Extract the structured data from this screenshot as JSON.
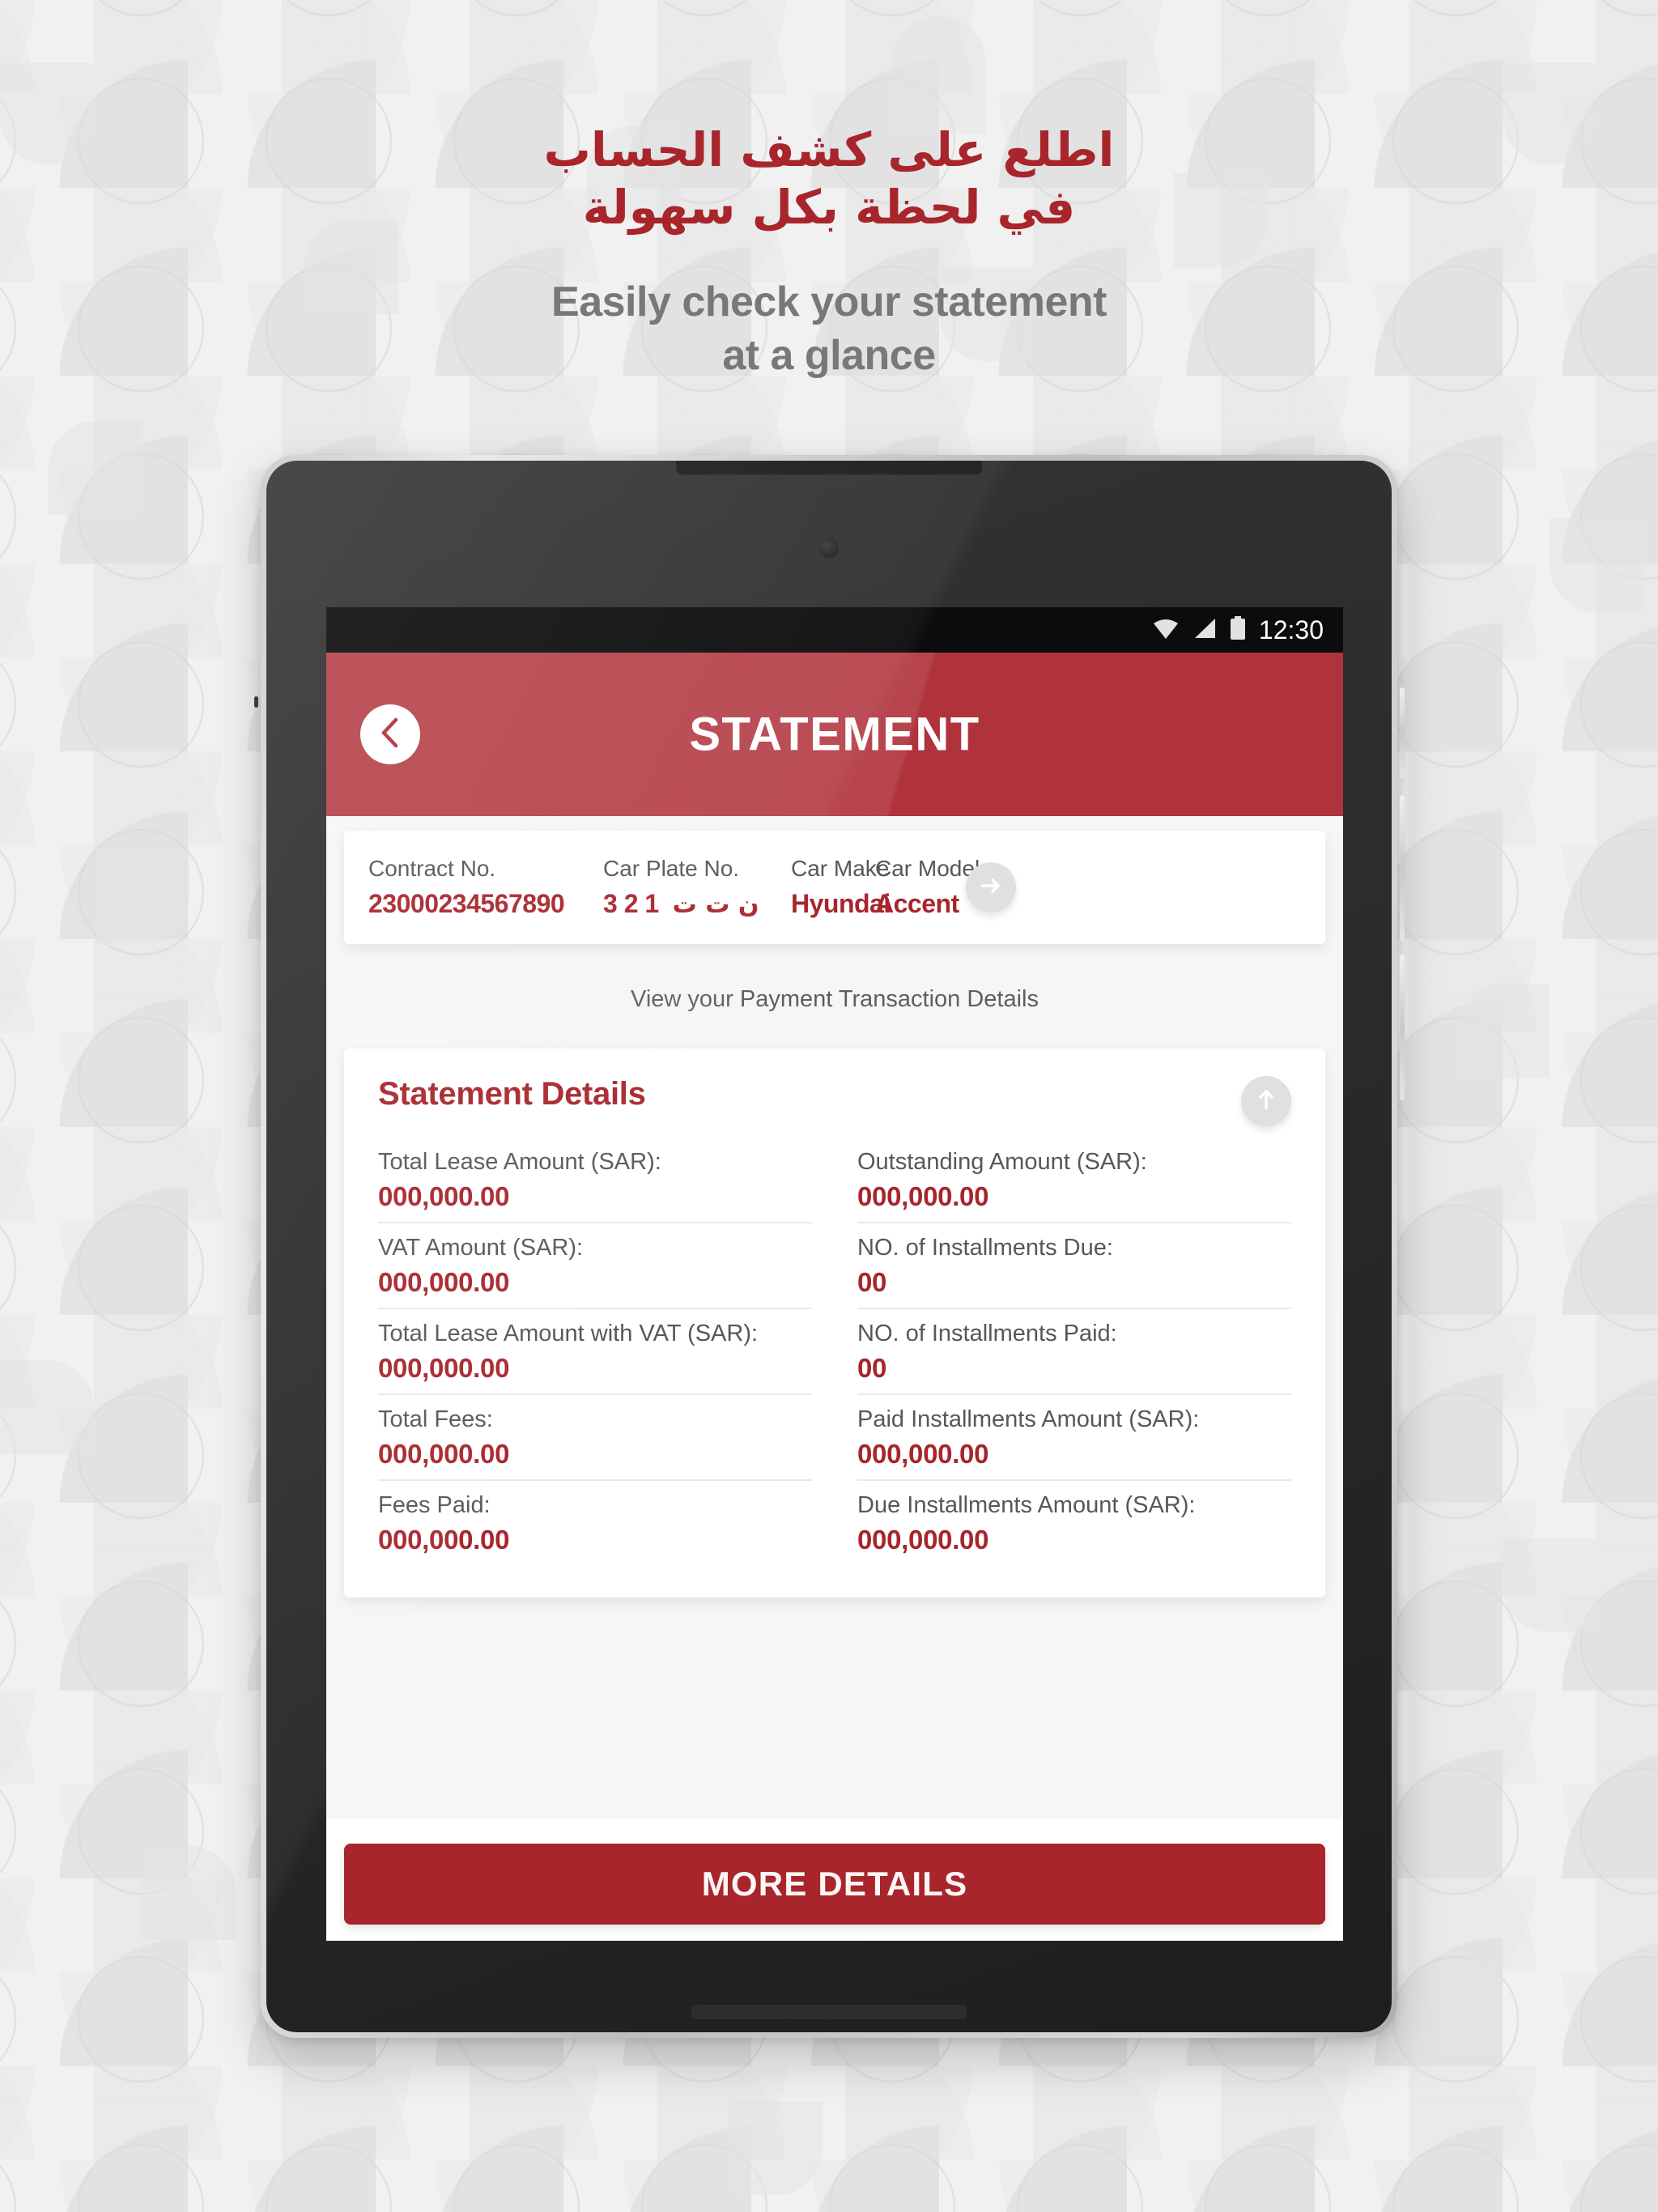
{
  "promo": {
    "arabic_line1": "اطلع على كشف الحساب",
    "arabic_line2": "في لحظة بكل سهولة",
    "english_line1": "Easily check your statement",
    "english_line2": "at a glance"
  },
  "colors": {
    "brand_red": "#a8252c",
    "header_red": "#b0333c",
    "label_gray": "#555758",
    "page_bg": "#f1f1f1"
  },
  "status_bar": {
    "time": "12:30",
    "wifi_icon": "wifi-icon",
    "signal_icon": "signal-icon",
    "battery_icon": "battery-icon"
  },
  "app_header": {
    "title": "STATEMENT",
    "back_icon": "chevron-left-icon"
  },
  "contract_card": {
    "fields": [
      {
        "label": "Contract No.",
        "value": "23000234567890"
      },
      {
        "label": "Car Plate No.",
        "digits": "3  2  1",
        "letters": "ن ت ت"
      },
      {
        "label": "Car Make",
        "value": "Hyundai"
      },
      {
        "label": "Car Model",
        "value": "Accent"
      }
    ],
    "next_icon": "arrow-right-icon"
  },
  "transaction_hint": "View your Payment Transaction Details",
  "statement_details": {
    "title": "Statement Details",
    "scroll_up_icon": "arrow-up-icon",
    "rows": [
      {
        "label": "Total Lease Amount (SAR):",
        "value": "000,000.00"
      },
      {
        "label": "Outstanding Amount (SAR):",
        "value": "000,000.00"
      },
      {
        "label": "VAT Amount (SAR):",
        "value": "000,000.00"
      },
      {
        "label": "NO. of Installments Due:",
        "value": "00"
      },
      {
        "label": "Total Lease Amount with VAT (SAR):",
        "value": "000,000.00"
      },
      {
        "label": "NO. of Installments Paid:",
        "value": "00"
      },
      {
        "label": "Total Fees:",
        "value": "000,000.00"
      },
      {
        "label": "Paid Installments Amount (SAR):",
        "value": "000,000.00"
      },
      {
        "label": "Fees Paid:",
        "value": "000,000.00"
      },
      {
        "label": "Due Installments Amount (SAR):",
        "value": "000,000.00"
      }
    ]
  },
  "footer": {
    "more_details_label": "MORE DETAILS"
  }
}
